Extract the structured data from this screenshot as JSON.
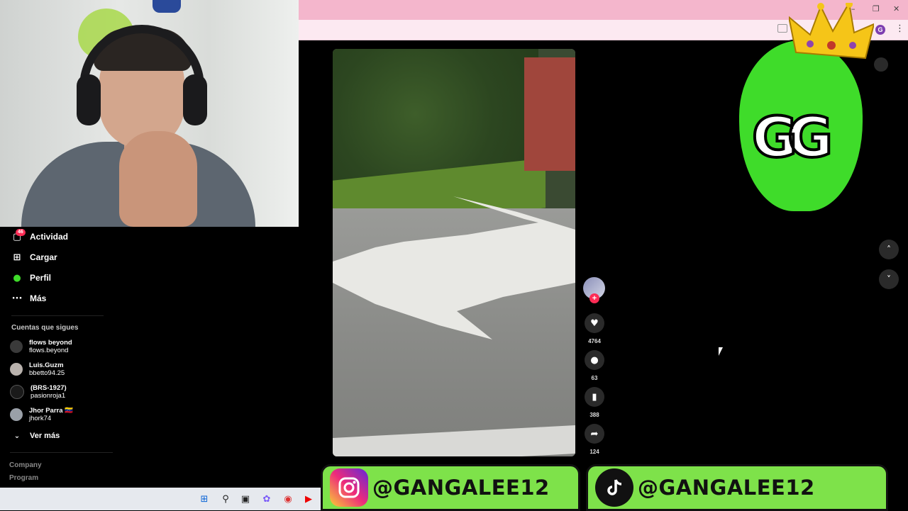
{
  "browser": {
    "profile_initial": "G",
    "window_controls": [
      "–",
      "❐",
      "✕"
    ],
    "menu_glyph": "⋮"
  },
  "sidebar": {
    "activity_badge": "46",
    "nav": [
      {
        "label": "Actividad",
        "icon": "inbox-icon",
        "glyph": "▢"
      },
      {
        "label": "Cargar",
        "icon": "upload-icon",
        "glyph": "⊞"
      },
      {
        "label": "Perfil",
        "icon": "profile-avatar-icon",
        "glyph": "●"
      },
      {
        "label": "Más",
        "icon": "more-icon",
        "glyph": "···"
      }
    ],
    "following_title": "Cuentas que sigues",
    "following": [
      {
        "name": "flows beyond",
        "handle": "flows.beyond",
        "avatar_color": "#3a3a3a"
      },
      {
        "name": "Luis.Guzm",
        "handle": "bbetto94.25",
        "avatar_color": "#b9b2ad"
      },
      {
        "name": "(BRS-1927)",
        "handle": "pasionroja1",
        "avatar_color": "#1a1a1a"
      },
      {
        "name": "Jhor Parra 🇻🇪",
        "handle": "jhork74",
        "avatar_color": "#9aa0a8"
      }
    ],
    "see_more": "Ver más",
    "footer": [
      "Company",
      "Program"
    ]
  },
  "actions": {
    "likes": "4764",
    "comments": "63",
    "saves": "388",
    "shares": "124"
  },
  "overlay": {
    "instagram_handle": "@GANGALEE12",
    "tiktok_handle": "@GANGALEE12",
    "mascot_text": "GG"
  },
  "colors": {
    "accent_red": "#fe2c55",
    "banner_green": "#7ee24a",
    "mascot_green": "#3fdc2a",
    "tab_pink": "#f4b6cc"
  }
}
